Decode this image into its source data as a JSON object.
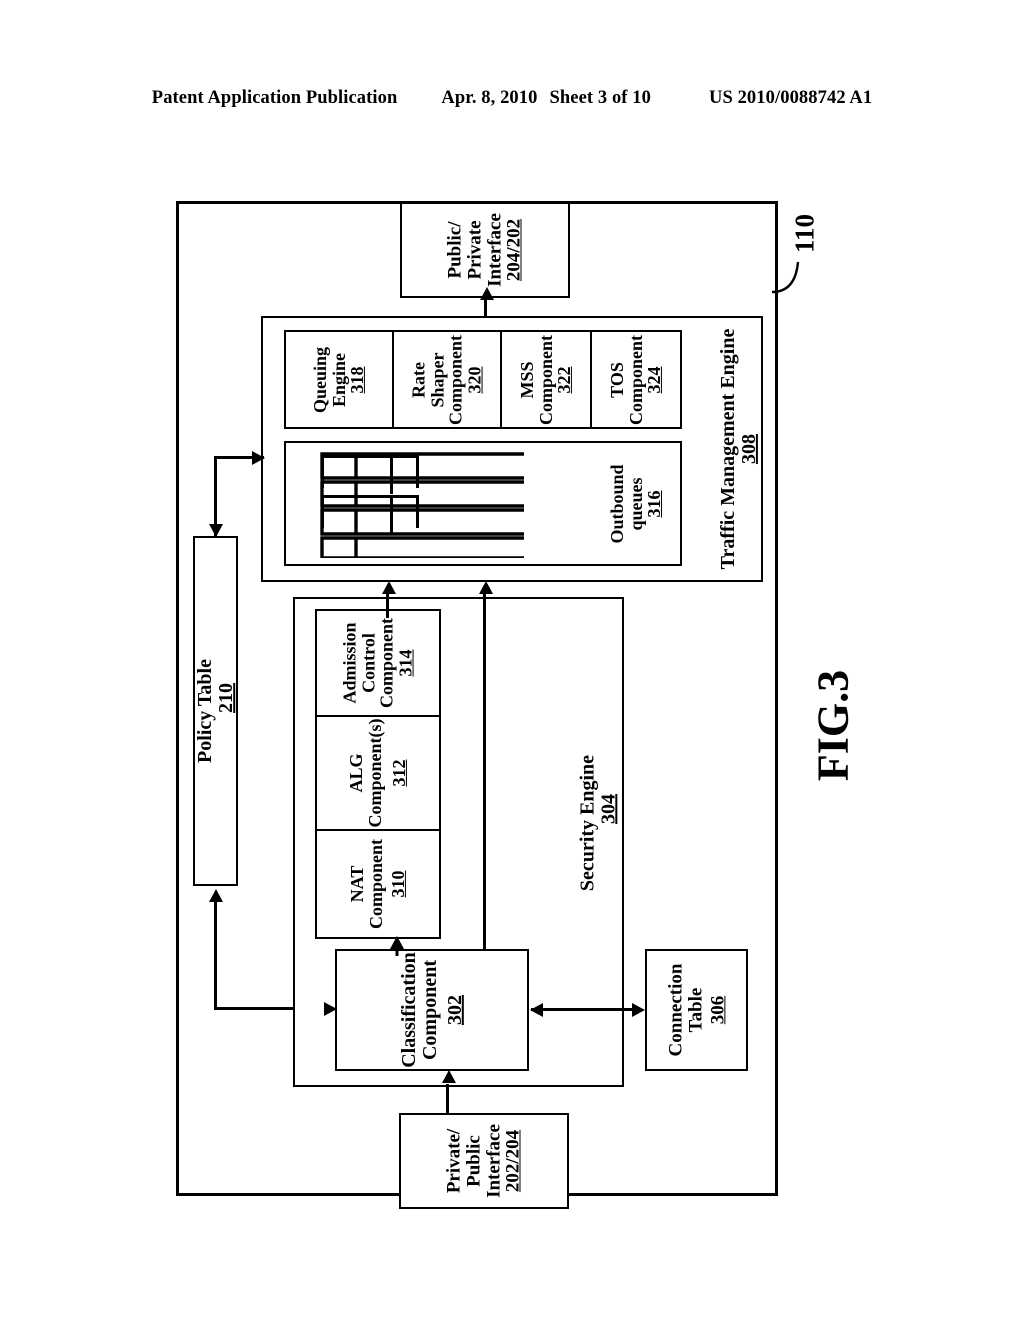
{
  "header": {
    "publication": "Patent Application Publication",
    "date": "Apr. 8, 2010",
    "sheet": "Sheet 3 of 10",
    "patent_number": "US 2010/0088742 A1"
  },
  "figure": {
    "label": "FIG.3",
    "device_reference": "110"
  },
  "blocks": {
    "public_private_interface": {
      "line1": "Public/",
      "line2": "Private",
      "line3": "Interface",
      "ref": "204/202"
    },
    "private_public_interface": {
      "line1": "Private/",
      "line2": "Public",
      "line3": "Interface",
      "ref": "202/204"
    },
    "traffic_management_engine": {
      "line1": "Traffic Management Engine",
      "ref": "308"
    },
    "queuing_engine": {
      "line1": "Queuing",
      "line2": "Engine",
      "ref": "318"
    },
    "rate_shaper_component": {
      "line1": "Rate",
      "line2": "Shaper",
      "line3": "Component",
      "ref": "320"
    },
    "mss_component": {
      "line1": "MSS",
      "line2": "Component",
      "ref": "322"
    },
    "tos_component": {
      "line1": "TOS",
      "line2": "Component",
      "ref": "324"
    },
    "outbound_queues": {
      "line1": "Outbound",
      "line2": "queues",
      "ref": "316",
      "queue_count": 4
    },
    "policy_table": {
      "line1": "Policy Table",
      "ref": "210"
    },
    "security_engine": {
      "line1": "Security Engine",
      "ref": "304"
    },
    "admission_control_component": {
      "line1": "Admission",
      "line2": "Control",
      "line3": "Component",
      "ref": "314"
    },
    "alg_component": {
      "line1": "ALG",
      "line2": "Component(s)",
      "ref": "312"
    },
    "nat_component": {
      "line1": "NAT",
      "line2": "Component",
      "ref": "310"
    },
    "classification_component": {
      "line1": "Classification",
      "line2": "Component",
      "ref": "302"
    },
    "connection_table": {
      "line1": "Connection",
      "line2": "Table",
      "ref": "306"
    }
  }
}
